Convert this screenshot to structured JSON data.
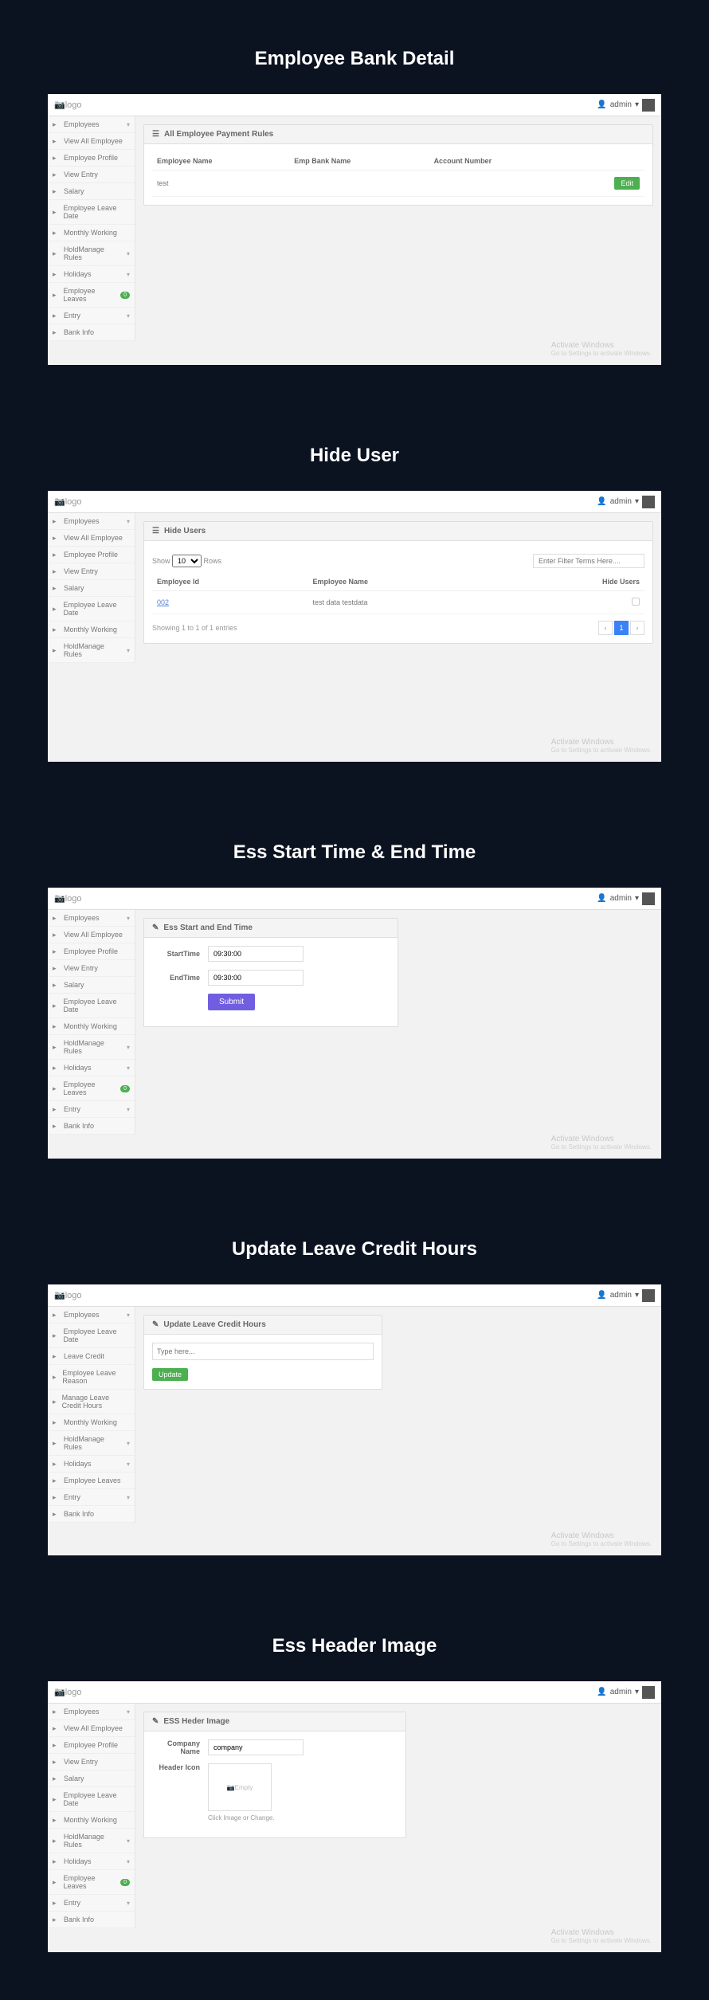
{
  "global": {
    "logo": "logo",
    "admin": "admin",
    "watermark_title": "Activate Windows",
    "watermark_sub": "Go to Settings to activate Windows."
  },
  "sidebar_full": [
    {
      "label": "Employees",
      "caret": true
    },
    {
      "label": "View All Employee"
    },
    {
      "label": "Employee Profile"
    },
    {
      "label": "View Entry"
    },
    {
      "label": "Salary"
    },
    {
      "label": "Employee Leave Date"
    },
    {
      "label": "Monthly Working"
    },
    {
      "label": "HoldManage Rules",
      "caret": true
    },
    {
      "label": "Holidays",
      "caret": true
    },
    {
      "label": "Employee Leaves",
      "badge": "0"
    },
    {
      "label": "Entry",
      "caret": true
    },
    {
      "label": "Bank Info"
    }
  ],
  "sidebar_hide": [
    {
      "label": "Employees",
      "caret": true
    },
    {
      "label": "View All Employee"
    },
    {
      "label": "Employee Profile"
    },
    {
      "label": "View Entry"
    },
    {
      "label": "Salary"
    },
    {
      "label": "Employee Leave Date"
    },
    {
      "label": "Monthly Working"
    },
    {
      "label": "HoldManage Rules",
      "caret": true
    }
  ],
  "sidebar_leave": [
    {
      "label": "Employees",
      "caret": true
    },
    {
      "label": "Employee Leave Date"
    },
    {
      "label": "Leave Credit"
    },
    {
      "label": "Employee Leave Reason"
    },
    {
      "label": "Manage Leave Credit Hours"
    },
    {
      "label": "Monthly Working"
    },
    {
      "label": "HoldManage Rules",
      "caret": true
    },
    {
      "label": "Holidays",
      "caret": true
    },
    {
      "label": "Employee Leaves"
    },
    {
      "label": "Entry",
      "caret": true
    },
    {
      "label": "Bank Info"
    }
  ],
  "sections": {
    "bank": {
      "title": "Employee Bank Detail",
      "panel_title": "All Employee Payment Rules",
      "columns": [
        "Employee Name",
        "Emp Bank Name",
        "Account Number",
        ""
      ],
      "rows": [
        [
          "test",
          "",
          "",
          "Edit"
        ]
      ],
      "edit_btn": "Edit"
    },
    "hide": {
      "title": "Hide User",
      "panel_title": "Hide Users",
      "show_prefix": "Show",
      "show_count": "10",
      "show_suffix": "Rows",
      "filter_placeholder": "Enter Filter Terms Here....",
      "columns": [
        "Employee Id",
        "Employee Name",
        "Hide Users"
      ],
      "rows": [
        [
          "002",
          "test data testdata",
          ""
        ]
      ],
      "footer": "Showing 1 to 1 of 1 entries"
    },
    "time": {
      "title": "Ess Start Time & End Time",
      "panel_title": "Ess Start and End Time",
      "start_label": "StartTime",
      "start_value": "09:30:00",
      "end_label": "EndTime",
      "end_value": "09:30:00",
      "submit": "Submit"
    },
    "leave": {
      "title": "Update Leave Credit Hours",
      "panel_title": "Update Leave Credit Hours",
      "placeholder": "Type here...",
      "update_btn": "Update"
    },
    "header": {
      "title": "Ess Header Image",
      "panel_title": "ESS Heder Image",
      "company_label": "Company Name",
      "company_value": "company",
      "icon_label": "Header Icon",
      "empty": "Empty",
      "hint": "Click Image or Change."
    }
  }
}
